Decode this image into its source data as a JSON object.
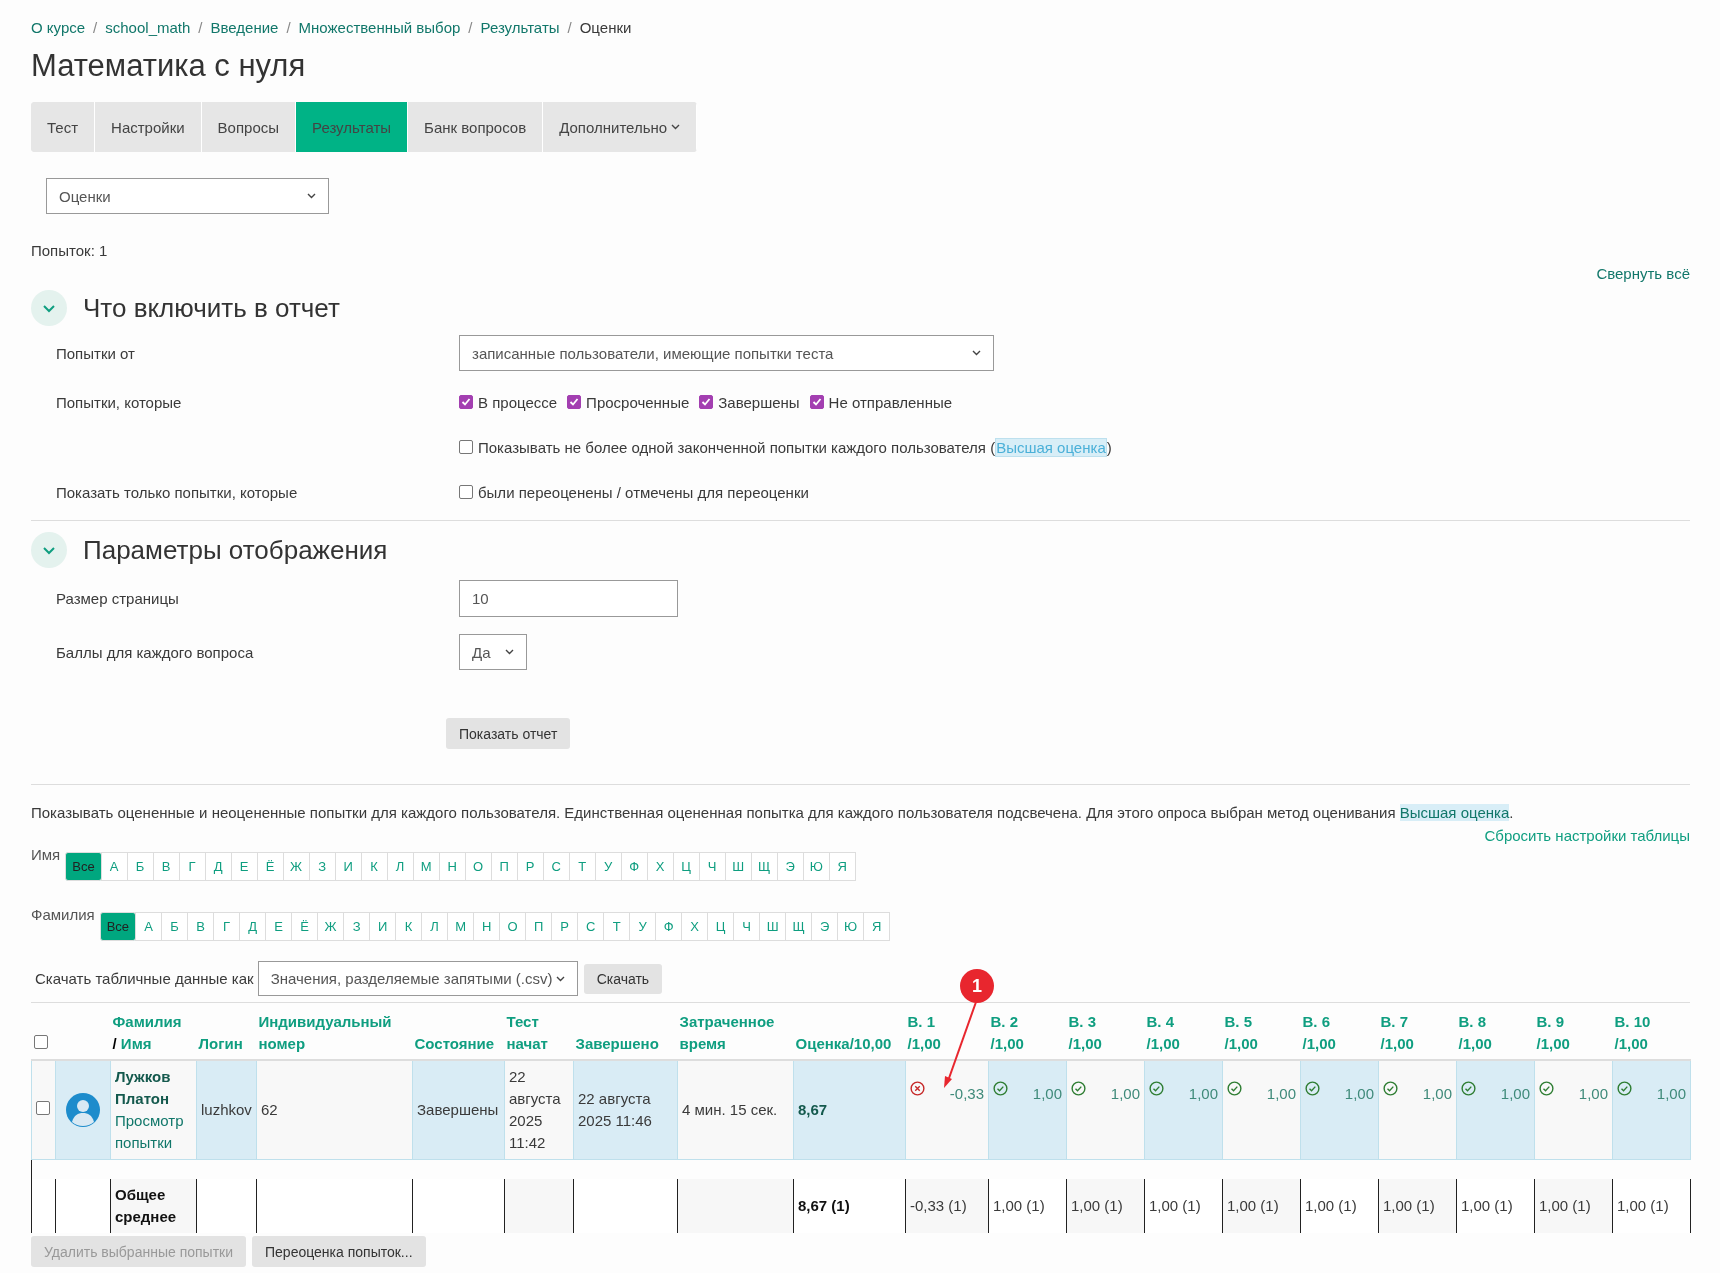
{
  "breadcrumb": {
    "separator": "/",
    "items": [
      {
        "label": "О курсе",
        "link": true
      },
      {
        "label": "school_math",
        "link": true
      },
      {
        "label": "Введение",
        "link": true
      },
      {
        "label": "Множественный выбор",
        "link": true
      },
      {
        "label": "Результаты",
        "link": true
      },
      {
        "label": "Оценки",
        "link": false
      }
    ]
  },
  "title": "Математика с нуля",
  "tabs": [
    {
      "label": "Тест",
      "selected": false,
      "dropdown": false
    },
    {
      "label": "Настройки",
      "selected": false,
      "dropdown": false
    },
    {
      "label": "Вопросы",
      "selected": false,
      "dropdown": false
    },
    {
      "label": "Результаты",
      "selected": true,
      "dropdown": false
    },
    {
      "label": "Банк вопросов",
      "selected": false,
      "dropdown": false
    },
    {
      "label": "Дополнительно",
      "selected": false,
      "dropdown": true
    }
  ],
  "report_select": "Оценки",
  "attempts_count": "Попыток: 1",
  "collapse_all": "Свернуть всё",
  "include_section": {
    "title": "Что включить в отчет",
    "expanded": true,
    "attempts_from": {
      "label": "Попытки от",
      "value": "записанные пользователи, имеющие попытки теста"
    },
    "attempts_which": {
      "label": "Попытки, которые",
      "states": [
        {
          "label": "В процессе",
          "checked": true
        },
        {
          "label": "Просроченные",
          "checked": true
        },
        {
          "label": "Завершены",
          "checked": true
        },
        {
          "label": "Не отправленные",
          "checked": true
        }
      ],
      "one_attempt": {
        "checked": false,
        "text": "Показывать не более одной законченной попытки каждого пользователя (",
        "link": "Высшая оценка",
        "after": ")"
      }
    },
    "only_show": {
      "label": "Показать только попытки, которые",
      "option": {
        "checked": false,
        "label": "были переоценены / отмечены для переоценки"
      }
    }
  },
  "display_section": {
    "title": "Параметры отображения",
    "expanded": true,
    "page_size": {
      "label": "Размер страницы",
      "value": "10"
    },
    "marks": {
      "label": "Баллы для каждого вопроса",
      "value": "Да"
    }
  },
  "show_report": "Показать отчет",
  "info": {
    "text": "Показывать оцененные и неоцененные попытки для каждого пользователя. Единственная оцененная попытка для каждого пользователя подсвечена. Для этого опроса выбран метод оценивания ",
    "link": "Высшая оценка",
    "after": "."
  },
  "reset_table": "Сбросить настройки таблицы",
  "first_name_filter": {
    "label": "Имя",
    "letters": [
      {
        "label": "Все",
        "selected": true
      },
      {
        "label": "А",
        "selected": false
      },
      {
        "label": "Б",
        "selected": false
      },
      {
        "label": "В",
        "selected": false
      },
      {
        "label": "Г",
        "selected": false
      },
      {
        "label": "Д",
        "selected": false
      },
      {
        "label": "Е",
        "selected": false
      },
      {
        "label": "Ё",
        "selected": false
      },
      {
        "label": "Ж",
        "selected": false
      },
      {
        "label": "З",
        "selected": false
      },
      {
        "label": "И",
        "selected": false
      },
      {
        "label": "К",
        "selected": false
      },
      {
        "label": "Л",
        "selected": false
      },
      {
        "label": "М",
        "selected": false
      },
      {
        "label": "Н",
        "selected": false
      },
      {
        "label": "О",
        "selected": false
      },
      {
        "label": "П",
        "selected": false
      },
      {
        "label": "Р",
        "selected": false
      },
      {
        "label": "С",
        "selected": false
      },
      {
        "label": "Т",
        "selected": false
      },
      {
        "label": "У",
        "selected": false
      },
      {
        "label": "Ф",
        "selected": false
      },
      {
        "label": "Х",
        "selected": false
      },
      {
        "label": "Ц",
        "selected": false
      },
      {
        "label": "Ч",
        "selected": false
      },
      {
        "label": "Ш",
        "selected": false
      },
      {
        "label": "Щ",
        "selected": false
      },
      {
        "label": "Э",
        "selected": false
      },
      {
        "label": "Ю",
        "selected": false
      },
      {
        "label": "Я",
        "selected": false
      }
    ]
  },
  "last_name_filter": {
    "label": "Фамилия",
    "letters": [
      {
        "label": "Все",
        "selected": true
      },
      {
        "label": "А",
        "selected": false
      },
      {
        "label": "Б",
        "selected": false
      },
      {
        "label": "В",
        "selected": false
      },
      {
        "label": "Г",
        "selected": false
      },
      {
        "label": "Д",
        "selected": false
      },
      {
        "label": "Е",
        "selected": false
      },
      {
        "label": "Ё",
        "selected": false
      },
      {
        "label": "Ж",
        "selected": false
      },
      {
        "label": "З",
        "selected": false
      },
      {
        "label": "И",
        "selected": false
      },
      {
        "label": "К",
        "selected": false
      },
      {
        "label": "Л",
        "selected": false
      },
      {
        "label": "М",
        "selected": false
      },
      {
        "label": "Н",
        "selected": false
      },
      {
        "label": "О",
        "selected": false
      },
      {
        "label": "П",
        "selected": false
      },
      {
        "label": "Р",
        "selected": false
      },
      {
        "label": "С",
        "selected": false
      },
      {
        "label": "Т",
        "selected": false
      },
      {
        "label": "У",
        "selected": false
      },
      {
        "label": "Ф",
        "selected": false
      },
      {
        "label": "Х",
        "selected": false
      },
      {
        "label": "Ц",
        "selected": false
      },
      {
        "label": "Ч",
        "selected": false
      },
      {
        "label": "Ш",
        "selected": false
      },
      {
        "label": "Щ",
        "selected": false
      },
      {
        "label": "Э",
        "selected": false
      },
      {
        "label": "Ю",
        "selected": false
      },
      {
        "label": "Я",
        "selected": false
      }
    ]
  },
  "download": {
    "label": "Скачать табличные данные как",
    "format": "Значения, разделяемые запятыми (.csv)",
    "button": "Скачать"
  },
  "table": {
    "select_all_checked": false,
    "headers": {
      "last_name": "Фамилия",
      "sep": "/",
      "first_name": "Имя",
      "login": "Логин",
      "id_number": "Индивидуальный номер",
      "state": "Состояние",
      "started": "Тест начат",
      "finished": "Завершено",
      "time": "Затраченное время",
      "grade": "Оценка/10,00"
    },
    "questions": [
      {
        "label": "В. 1",
        "max": "/1,00"
      },
      {
        "label": "В. 2",
        "max": "/1,00"
      },
      {
        "label": "В. 3",
        "max": "/1,00"
      },
      {
        "label": "В. 4",
        "max": "/1,00"
      },
      {
        "label": "В. 5",
        "max": "/1,00"
      },
      {
        "label": "В. 6",
        "max": "/1,00"
      },
      {
        "label": "В. 7",
        "max": "/1,00"
      },
      {
        "label": "В. 8",
        "max": "/1,00"
      },
      {
        "label": "В. 9",
        "max": "/1,00"
      },
      {
        "label": "В. 10",
        "max": "/1,00"
      }
    ],
    "rows": [
      {
        "checked": false,
        "highlighted": true,
        "name": "Лужков Платон",
        "review": "Просмотр попытки",
        "login": "luzhkov",
        "id_number": "62",
        "state": "Завершены",
        "started": "22 августа 2025 11:42",
        "finished": "22 августа 2025 11:46",
        "time": "4 мин. 15 сек.",
        "grade": "8,67",
        "marks": [
          {
            "kind": "incorrect",
            "value": "-0,33"
          },
          {
            "kind": "correct",
            "value": "1,00"
          },
          {
            "kind": "correct",
            "value": "1,00"
          },
          {
            "kind": "correct",
            "value": "1,00"
          },
          {
            "kind": "correct",
            "value": "1,00"
          },
          {
            "kind": "correct",
            "value": "1,00"
          },
          {
            "kind": "correct",
            "value": "1,00"
          },
          {
            "kind": "correct",
            "value": "1,00"
          },
          {
            "kind": "correct",
            "value": "1,00"
          },
          {
            "kind": "correct",
            "value": "1,00"
          }
        ]
      }
    ],
    "average": {
      "label": "Общее среднее",
      "grade": "8,67 (1)",
      "marks": [
        "-0,33 (1)",
        "1,00 (1)",
        "1,00 (1)",
        "1,00 (1)",
        "1,00 (1)",
        "1,00 (1)",
        "1,00 (1)",
        "1,00 (1)",
        "1,00 (1)",
        "1,00 (1)"
      ]
    }
  },
  "bottom_buttons": [
    {
      "label": "Удалить выбранные попытки",
      "disabled": true
    },
    {
      "label": "Переоценка попыток...",
      "disabled": false
    }
  ],
  "annotation": {
    "label": "1"
  }
}
